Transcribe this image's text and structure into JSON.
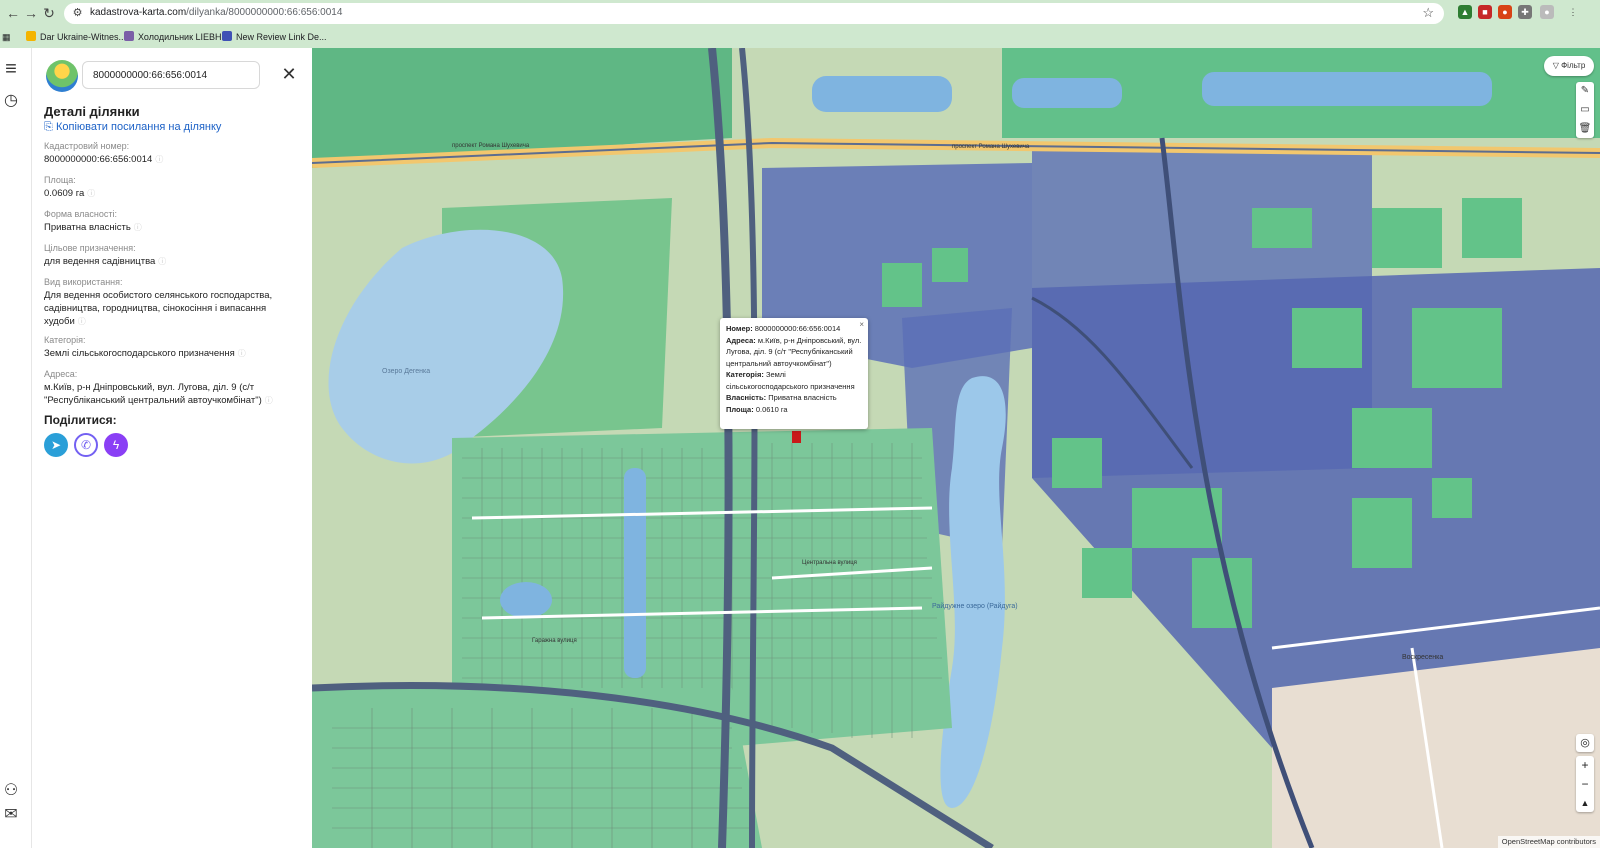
{
  "browser": {
    "url_host": "kadastrova-karta.com",
    "url_path": "/dilyanka/8000000000:66:656:0014",
    "bookmarks": [
      "Dar Ukraine-Witnes...",
      "Холодильник LIEBH...",
      "New Review Link De..."
    ]
  },
  "panel": {
    "search_value": "8000000000:66:656:0014",
    "title": "Деталі ділянки",
    "copy_link": "Копіювати посилання на ділянку",
    "fields": [
      {
        "label": "Кадастровий номер:",
        "value": "8000000000:66:656:0014"
      },
      {
        "label": "Площа:",
        "value": "0.0609 га"
      },
      {
        "label": "Форма власності:",
        "value": "Приватна власність"
      },
      {
        "label": "Цільове призначення:",
        "value": "для ведення садівництва"
      },
      {
        "label": "Вид використання:",
        "value": "Для ведення особистого селянського господарства, садівництва, городництва, сінокосіння і випасання худоби"
      },
      {
        "label": "Категорія:",
        "value": "Землі сільськогосподарського призначення"
      },
      {
        "label": "Адреса:",
        "value": "м.Київ, р-н Дніпровський, вул. Лугова, діл. 9 (с/т \"Республіканський центральний автоучкомбінат\")"
      }
    ],
    "share_title": "Поділитися:",
    "share_icons": [
      "telegram-icon",
      "viber-icon",
      "messenger-icon"
    ]
  },
  "popup": {
    "number_label": "Номер:",
    "number_value": "8000000000:66:656:0014",
    "address_label": "Адреса:",
    "address_value": "м.Київ, р-н Дніпровський, вул. Лугова, діл. 9 (с/т \"Республіканський центральний автоучкомбінат\")",
    "category_label": "Категорія:",
    "category_value": "Землі сільськогосподарського призначення",
    "ownership_label": "Власність:",
    "ownership_value": "Приватна власність",
    "area_label": "Площа:",
    "area_value": "0.0610 га",
    "close": "×"
  },
  "map": {
    "filter_label": "Фільтр",
    "zoom_in": "+",
    "zoom_out": "−",
    "attribution": "OpenStreetMap contributors",
    "labels": {
      "avenue": "проспект Романа Шухевича",
      "lake_degenka": "Озеро Дегенка",
      "lake_raduzhne": "Райдужне озеро (Райдуга)",
      "street_central": "Центральна вулиця",
      "street_hardens": "Гаражна вулиця",
      "district": "Воскресенка"
    },
    "colors": {
      "residential": "#5b6fb7",
      "green_parcel": "#63c389",
      "water": "#a8cde8",
      "road": "#f2c76e",
      "highway": "#6d7fa6"
    }
  }
}
